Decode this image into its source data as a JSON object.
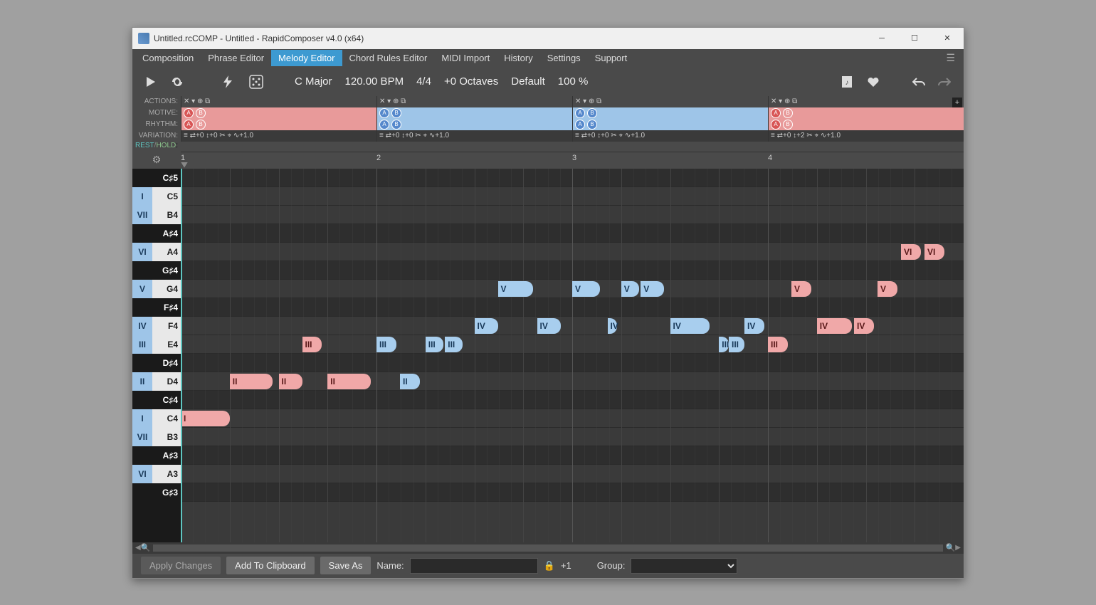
{
  "window": {
    "title": "Untitled.rcCOMP - Untitled - RapidComposer v4.0 (x64)"
  },
  "menu": {
    "tabs": [
      "Composition",
      "Phrase Editor",
      "Melody Editor",
      "Chord Rules Editor",
      "MIDI Import",
      "History",
      "Settings",
      "Support"
    ],
    "active": 2
  },
  "toolbar": {
    "key": "C Major",
    "tempo": "120.00 BPM",
    "timesig": "4/4",
    "octaves": "+0 Octaves",
    "preset": "Default",
    "zoom": "100 %"
  },
  "sections": {
    "labels": {
      "actions": "ACTIONS:",
      "motive": "MOTIVE:",
      "rhythm": "RHYTHM:",
      "variation": "VARIATION:"
    },
    "cols": [
      {
        "motive": "pink",
        "rhythm": "pink",
        "variation": "+0  +0  +1.0"
      },
      {
        "motive": "blue",
        "rhythm": "blue",
        "variation": "+0  +0  +1.0"
      },
      {
        "motive": "blue",
        "rhythm": "blue",
        "variation": "+0  +0  +1.0"
      },
      {
        "motive": "pink",
        "rhythm": "pink",
        "variation": "+0  +2  +1.0"
      }
    ]
  },
  "resthold": {
    "rest": "REST",
    "hold": "HOLD"
  },
  "timeline": {
    "bars": [
      "1",
      "2",
      "3",
      "4"
    ]
  },
  "pitches": [
    {
      "deg": "",
      "note": "C♯5",
      "white": false
    },
    {
      "deg": "I",
      "note": "C5",
      "white": true
    },
    {
      "deg": "VII",
      "note": "B4",
      "white": true
    },
    {
      "deg": "",
      "note": "A♯4",
      "white": false
    },
    {
      "deg": "VI",
      "note": "A4",
      "white": true
    },
    {
      "deg": "",
      "note": "G♯4",
      "white": false
    },
    {
      "deg": "V",
      "note": "G4",
      "white": true
    },
    {
      "deg": "",
      "note": "F♯4",
      "white": false
    },
    {
      "deg": "IV",
      "note": "F4",
      "white": true
    },
    {
      "deg": "III",
      "note": "E4",
      "white": true
    },
    {
      "deg": "",
      "note": "D♯4",
      "white": false
    },
    {
      "deg": "II",
      "note": "D4",
      "white": true
    },
    {
      "deg": "",
      "note": "C♯4",
      "white": false
    },
    {
      "deg": "I",
      "note": "C4",
      "white": true
    },
    {
      "deg": "VII",
      "note": "B3",
      "white": true
    },
    {
      "deg": "",
      "note": "A♯3",
      "white": false
    },
    {
      "deg": "VI",
      "note": "A3",
      "white": true
    },
    {
      "deg": "",
      "note": "G♯3",
      "white": false
    }
  ],
  "notes": [
    {
      "row": 13,
      "start": 0.0,
      "len": 0.25,
      "label": "I",
      "color": "pink"
    },
    {
      "row": 11,
      "start": 0.25,
      "len": 0.22,
      "label": "II",
      "color": "pink"
    },
    {
      "row": 11,
      "start": 0.5,
      "len": 0.12,
      "label": "II",
      "color": "pink"
    },
    {
      "row": 9,
      "start": 0.62,
      "len": 0.1,
      "label": "III",
      "color": "pink"
    },
    {
      "row": 11,
      "start": 0.75,
      "len": 0.22,
      "label": "II",
      "color": "pink"
    },
    {
      "row": 9,
      "start": 1.0,
      "len": 0.1,
      "label": "III",
      "color": "blue"
    },
    {
      "row": 11,
      "start": 1.12,
      "len": 0.1,
      "label": "II",
      "color": "blue"
    },
    {
      "row": 9,
      "start": 1.25,
      "len": 0.09,
      "label": "III",
      "color": "blue"
    },
    {
      "row": 9,
      "start": 1.35,
      "len": 0.09,
      "label": "III",
      "color": "blue"
    },
    {
      "row": 8,
      "start": 1.5,
      "len": 0.12,
      "label": "IV",
      "color": "blue"
    },
    {
      "row": 6,
      "start": 1.62,
      "len": 0.18,
      "label": "V",
      "color": "blue"
    },
    {
      "row": 8,
      "start": 1.82,
      "len": 0.12,
      "label": "IV",
      "color": "blue"
    },
    {
      "row": 6,
      "start": 2.0,
      "len": 0.14,
      "label": "V",
      "color": "blue"
    },
    {
      "row": 8,
      "start": 2.18,
      "len": 0.05,
      "label": "IV",
      "color": "blue"
    },
    {
      "row": 6,
      "start": 2.25,
      "len": 0.09,
      "label": "V",
      "color": "blue"
    },
    {
      "row": 6,
      "start": 2.35,
      "len": 0.12,
      "label": "V",
      "color": "blue"
    },
    {
      "row": 8,
      "start": 2.5,
      "len": 0.2,
      "label": "IV",
      "color": "blue"
    },
    {
      "row": 9,
      "start": 2.75,
      "len": 0.05,
      "label": "III",
      "color": "blue"
    },
    {
      "row": 9,
      "start": 2.8,
      "len": 0.08,
      "label": "III",
      "color": "blue"
    },
    {
      "row": 8,
      "start": 2.88,
      "len": 0.1,
      "label": "IV",
      "color": "blue"
    },
    {
      "row": 9,
      "start": 3.0,
      "len": 0.1,
      "label": "III",
      "color": "pink"
    },
    {
      "row": 6,
      "start": 3.12,
      "len": 0.1,
      "label": "V",
      "color": "pink"
    },
    {
      "row": 8,
      "start": 3.25,
      "len": 0.18,
      "label": "IV",
      "color": "pink"
    },
    {
      "row": 8,
      "start": 3.44,
      "len": 0.1,
      "label": "IV",
      "color": "pink"
    },
    {
      "row": 6,
      "start": 3.56,
      "len": 0.1,
      "label": "V",
      "color": "pink"
    },
    {
      "row": 4,
      "start": 3.68,
      "len": 0.1,
      "label": "VI",
      "color": "pink"
    },
    {
      "row": 4,
      "start": 3.8,
      "len": 0.1,
      "label": "VI",
      "color": "pink"
    }
  ],
  "bottom": {
    "apply": "Apply Changes",
    "clipboard": "Add To Clipboard",
    "saveas": "Save As",
    "name_lbl": "Name:",
    "name_val": "",
    "plus": "+1",
    "group_lbl": "Group:",
    "group_val": ""
  }
}
